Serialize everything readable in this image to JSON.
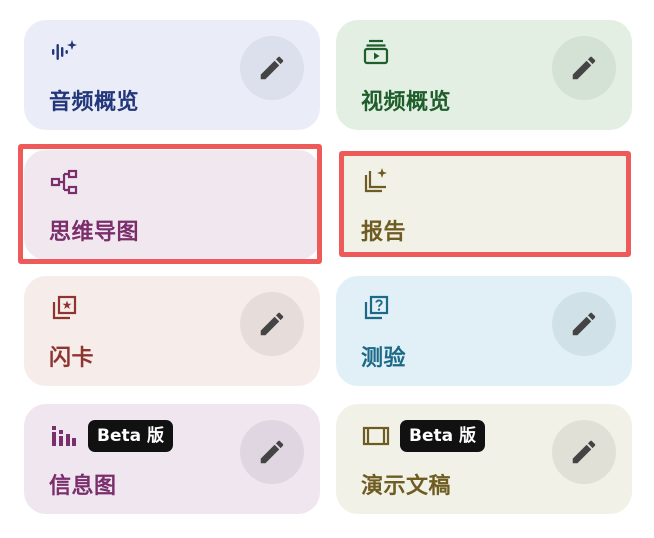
{
  "cards": [
    {
      "label": "音频概览",
      "icon": "audio-sparkle-icon",
      "bg": "#eaedf8",
      "color": "#22367a",
      "edit": true,
      "badge": null
    },
    {
      "label": "视频概览",
      "icon": "video-play-icon",
      "bg": "#e4efe4",
      "color": "#1e5e2a",
      "edit": true,
      "badge": null
    },
    {
      "label": "思维导图",
      "icon": "mind-map-icon",
      "bg": "#f1e7ef",
      "color": "#7a2e6b",
      "edit": false,
      "badge": null
    },
    {
      "label": "报告",
      "icon": "report-sparkle-icon",
      "bg": "#f1f1e8",
      "color": "#6e5c21",
      "edit": false,
      "badge": null
    },
    {
      "label": "闪卡",
      "icon": "flashcard-icon",
      "bg": "#f6ecea",
      "color": "#8e3530",
      "edit": true,
      "badge": null
    },
    {
      "label": "测验",
      "icon": "quiz-icon",
      "bg": "#e0f0f6",
      "color": "#1c6a88",
      "edit": true,
      "badge": null
    },
    {
      "label": "信息图",
      "icon": "infographic-icon",
      "bg": "#efe6f0",
      "color": "#7a2e6b",
      "edit": true,
      "badge": "Beta 版"
    },
    {
      "label": "演示文稿",
      "icon": "slides-icon",
      "bg": "#f1f1e8",
      "color": "#6e5c21",
      "edit": true,
      "badge": "Beta 版"
    }
  ],
  "colors": {
    "highlight": "#ee5a5a",
    "badge_bg": "#111111",
    "pencil": "#444444"
  }
}
